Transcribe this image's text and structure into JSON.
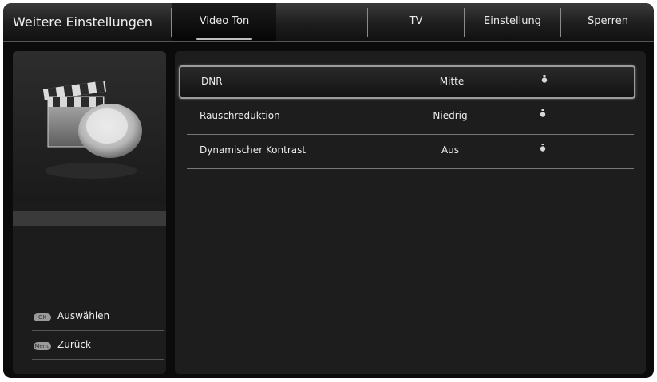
{
  "header": {
    "title": "Weitere Einstellungen",
    "tabs": [
      {
        "label": "Video Ton",
        "active": true
      },
      {
        "label": "TV",
        "active": false
      },
      {
        "label": "Einstellung",
        "active": false
      },
      {
        "label": "Sperren",
        "active": false
      }
    ]
  },
  "settings": [
    {
      "name": "DNR",
      "value": "Mitte",
      "selected": true
    },
    {
      "name": "Rauschreduktion",
      "value": "Niedrig",
      "selected": false
    },
    {
      "name": "Dynamischer Kontrast",
      "value": "Aus",
      "selected": false
    }
  ],
  "hints": [
    {
      "key": "OK",
      "label": "Auswählen",
      "icon": "ok-key-icon"
    },
    {
      "key": "Menu",
      "label": "Zurück",
      "icon": "menu-key-icon"
    }
  ],
  "colors": {
    "background": "#0b0b0b",
    "panel": "#1d1d1d",
    "highlight": "#9c9c9c"
  }
}
